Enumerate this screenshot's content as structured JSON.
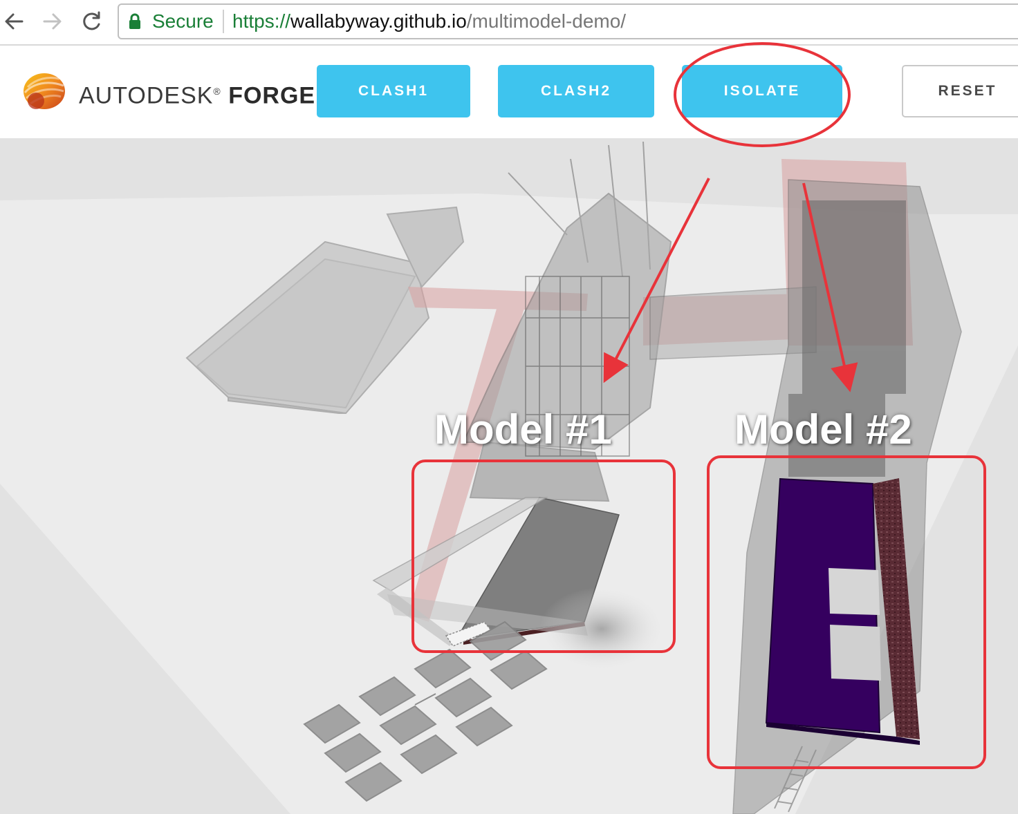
{
  "browser": {
    "secure_label": "Secure",
    "url_scheme": "https://",
    "url_host": "wallabyway.github.io",
    "url_path": "/multimodel-demo/"
  },
  "header": {
    "brand_name": "AUTODESK",
    "brand_product": "FORGE",
    "brand_mark": "®",
    "buttons": {
      "clash1": "CLASH1",
      "clash2": "CLASH2",
      "isolate": "ISOLATE",
      "reset": "RESET"
    }
  },
  "viewer": {
    "model_1_label": "Model #1",
    "model_2_label": "Model #2"
  },
  "colors": {
    "button_primary": "#3ec4ee",
    "annotation_red": "#e8333a",
    "secure_green": "#1a7f37",
    "model2_purple": "#35005f"
  },
  "icons": [
    "back-arrow-icon",
    "forward-arrow-icon",
    "reload-icon",
    "lock-icon",
    "autodesk-logo-icon"
  ]
}
